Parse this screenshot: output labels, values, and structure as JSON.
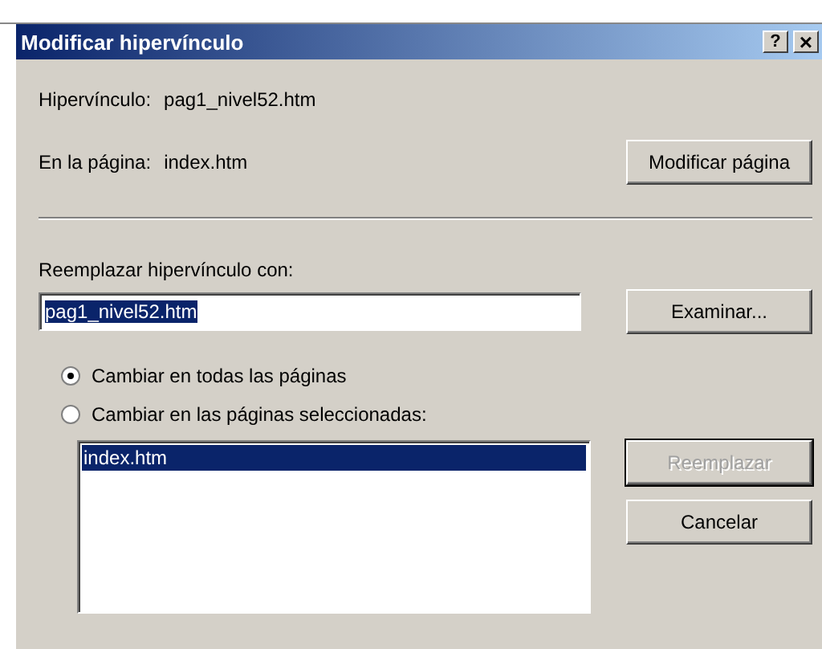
{
  "window": {
    "title": "Modificar hipervínculo",
    "title_buttons": [
      {
        "kind": "help",
        "label": "?"
      },
      {
        "kind": "close",
        "label": "×"
      }
    ]
  },
  "hyperlink": {
    "label": "Hipervínculo:",
    "value": "pag1_nivel52.htm"
  },
  "in_page": {
    "label": "En la página:",
    "value": "index.htm"
  },
  "modify_page_button": {
    "label": "Modificar página",
    "disabled": false,
    "default": false
  },
  "replace": {
    "label": "Reemplazar hipervínculo con:",
    "value": "pag1_nivel52.htm",
    "value_selected": true
  },
  "browse_button": {
    "label": "Examinar...",
    "disabled": false,
    "default": false
  },
  "scope_options": [
    {
      "label": "Cambiar en todas las páginas",
      "selected": true
    },
    {
      "label": "Cambiar en las páginas seleccionadas:",
      "selected": false
    }
  ],
  "pages": [
    {
      "label": "index.htm",
      "selected": true
    }
  ],
  "buttons": [
    {
      "label": "Reemplazar",
      "disabled": true,
      "default": true
    },
    {
      "label": "Cancelar",
      "disabled": false,
      "default": false
    }
  ]
}
